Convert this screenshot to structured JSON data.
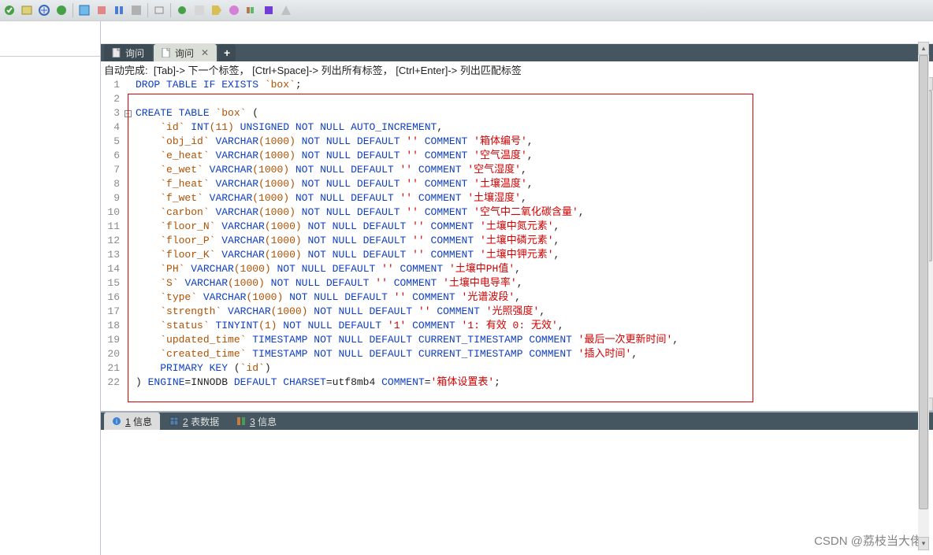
{
  "tabs": {
    "inactive": "询问",
    "active": "询问",
    "add": "+"
  },
  "hint": "自动完成:  [Tab]-> 下一个标签， [Ctrl+Space]-> 列出所有标签， [Ctrl+Enter]-> 列出匹配标签",
  "lines": [
    1,
    2,
    3,
    4,
    5,
    6,
    7,
    8,
    9,
    10,
    11,
    12,
    13,
    14,
    15,
    16,
    17,
    18,
    19,
    20,
    21,
    22
  ],
  "code": {
    "l1": {
      "pre": "DROP TABLE IF EXISTS ",
      "tbl": "`box`",
      "end": ";"
    },
    "l3": {
      "a": "CREATE TABLE ",
      "tbl": "`box`",
      "b": " ("
    },
    "l4": {
      "indent": "    ",
      "name": "`id`",
      "sp": " ",
      "ty": "INT",
      "paren": "(11)",
      "mods": " UNSIGNED NOT NULL AUTO_INCREMENT",
      "end": ","
    },
    "std_cols": [
      {
        "line": 5,
        "name": "`obj_id`",
        "str": "'箱体编号'"
      },
      {
        "line": 6,
        "name": "`e_heat`",
        "str": "'空气温度'"
      },
      {
        "line": 7,
        "name": "`e_wet`",
        "str": "'空气湿度'"
      },
      {
        "line": 8,
        "name": "`f_heat`",
        "str": "'土壤温度'"
      },
      {
        "line": 9,
        "name": "`f_wet`",
        "str": "'土壤湿度'"
      },
      {
        "line": 10,
        "name": "`carbon`",
        "str": "'空气中二氧化碳含量'"
      },
      {
        "line": 11,
        "name": "`floor_N`",
        "str": "'土壤中氮元素'"
      },
      {
        "line": 12,
        "name": "`floor_P`",
        "str": "'土壤中磷元素'"
      },
      {
        "line": 13,
        "name": "`floor_K`",
        "str": "'土壤中钾元素'"
      },
      {
        "line": 14,
        "name": "`PH`",
        "str": "'土壤中PH值'"
      },
      {
        "line": 15,
        "name": "`S`",
        "str": "'土壤中电导率'"
      },
      {
        "line": 16,
        "name": "`type`",
        "str": "'光谱波段'"
      },
      {
        "line": 17,
        "name": "`strength`",
        "str": "'光照强度'"
      }
    ],
    "std_tpl": {
      "ty": "VARCHAR",
      "paren": "(1000)",
      "mods": " NOT NULL DEFAULT ",
      "def": "''",
      "com": " COMMENT "
    },
    "l18": {
      "name": "`status`",
      "ty": "TINYINT",
      "paren": "(1)",
      "mods": " NOT NULL DEFAULT ",
      "def": "'1'",
      "com": " COMMENT ",
      "str": "'1: 有效 0: 无效'"
    },
    "ts_tpl": {
      "ty": "TIMESTAMP",
      "mods": " NOT NULL DEFAULT CURRENT_TIMESTAMP COMMENT "
    },
    "l19": {
      "name": "`updated_time`",
      "str": "'最后一次更新时间'"
    },
    "l20": {
      "name": "`created_time`",
      "str": "'插入时间'"
    },
    "l21": {
      "a": "    PRIMARY KEY ",
      "b": "(",
      "c": "`id`",
      "d": ")"
    },
    "l22": {
      "a": ") ",
      "b": "ENGINE",
      "c": "=INNODB ",
      "d": "DEFAULT CHARSET",
      "e": "=utf8mb4 ",
      "f": "COMMENT",
      "g": "=",
      "h": "'箱体设置表'",
      "i": ";"
    }
  },
  "result_tabs": {
    "t1": "1 信息",
    "t2": "2 表数据",
    "t3": "3 信息"
  },
  "watermark": "CSDN @荔枝当大佬"
}
